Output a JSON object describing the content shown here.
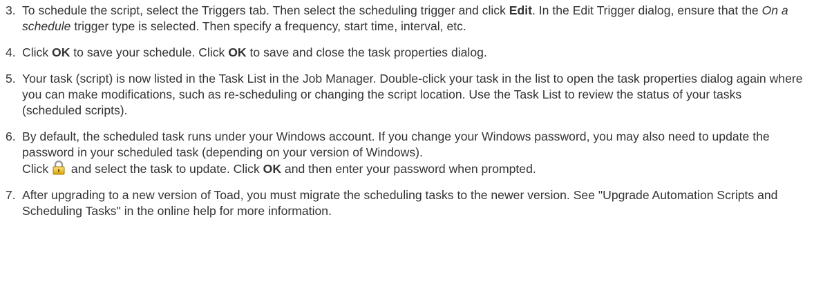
{
  "steps": [
    {
      "num": "3.",
      "parts": [
        {
          "t": "To schedule the script, select the Triggers tab. Then select the scheduling trigger and click "
        },
        {
          "t": "Edit",
          "b": true
        },
        {
          "t": ". In the Edit Trigger dialog, ensure that the "
        },
        {
          "t": "On a schedule",
          "i": true
        },
        {
          "t": " trigger type is selected. Then specify a frequency, start time, interval, etc."
        }
      ]
    },
    {
      "num": "4.",
      "parts": [
        {
          "t": "Click "
        },
        {
          "t": "OK",
          "b": true
        },
        {
          "t": " to save your schedule. Click "
        },
        {
          "t": "OK",
          "b": true
        },
        {
          "t": " to save and close the task properties dialog."
        }
      ]
    },
    {
      "num": "5.",
      "parts": [
        {
          "t": "Your task (script) is now listed in the Task List in the Job Manager. Double-click your task in the list to open the task properties dialog again where you can make modifications, such as re-scheduling or changing the script location. Use the Task List to review the status of your tasks (scheduled scripts)."
        }
      ]
    },
    {
      "num": "6.",
      "parts": [
        {
          "t": "By default, the scheduled task runs under your Windows account. If you change your Windows password, you may also need to update the password in your scheduled task (depending on your version of Windows)."
        },
        {
          "br": true
        },
        {
          "t": "Click "
        },
        {
          "icon": "lock-icon"
        },
        {
          "t": " and select the task to update. Click "
        },
        {
          "t": "OK",
          "b": true
        },
        {
          "t": " and then enter your password when prompted."
        }
      ]
    },
    {
      "num": "7.",
      "parts": [
        {
          "t": "After upgrading to a new version of Toad, you must migrate the scheduling tasks to the newer version. See \"Upgrade Automation Scripts and Scheduling Tasks\" in the online help for more information."
        }
      ]
    }
  ]
}
